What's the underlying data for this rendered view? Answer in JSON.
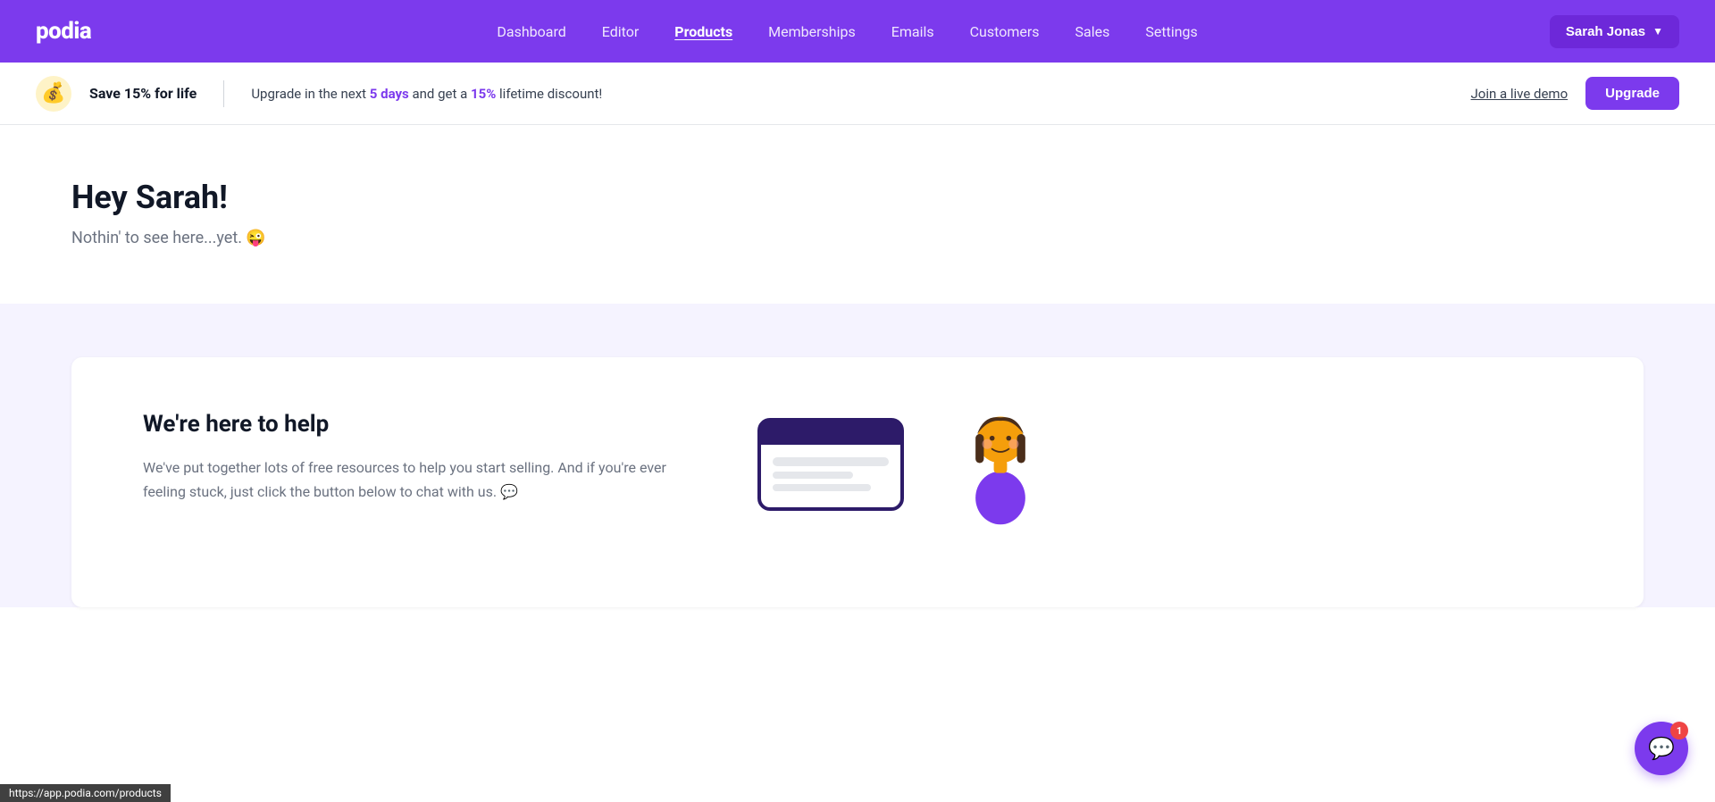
{
  "nav": {
    "logo": "podia",
    "links": [
      {
        "id": "dashboard",
        "label": "Dashboard",
        "active": false
      },
      {
        "id": "editor",
        "label": "Editor",
        "active": false
      },
      {
        "id": "products",
        "label": "Products",
        "active": true
      },
      {
        "id": "memberships",
        "label": "Memberships",
        "active": false
      },
      {
        "id": "emails",
        "label": "Emails",
        "active": false
      },
      {
        "id": "customers",
        "label": "Customers",
        "active": false
      },
      {
        "id": "sales",
        "label": "Sales",
        "active": false
      },
      {
        "id": "settings",
        "label": "Settings",
        "active": false
      }
    ],
    "user_button": "Sarah Jonas",
    "user_chevron": "▼"
  },
  "banner": {
    "icon": "💰",
    "title": "Save 15% for life",
    "text_prefix": "Upgrade in the next ",
    "days": "5 days",
    "text_middle": " and get a ",
    "pct": "15%",
    "text_suffix": " lifetime discount!",
    "demo_link": "Join a live demo",
    "upgrade_btn": "Upgrade"
  },
  "main": {
    "greeting": "Hey Sarah!",
    "subtext": "Nothin' to see here...yet. 😜"
  },
  "help": {
    "title": "We're here to help",
    "description": "We've put together lots of free resources to help you start selling. And if you're ever feeling stuck, just click the button below to chat with us. 💬"
  },
  "chat": {
    "badge_count": "1",
    "icon": "💬"
  },
  "status_bar": {
    "url": "https://app.podia.com/products"
  }
}
